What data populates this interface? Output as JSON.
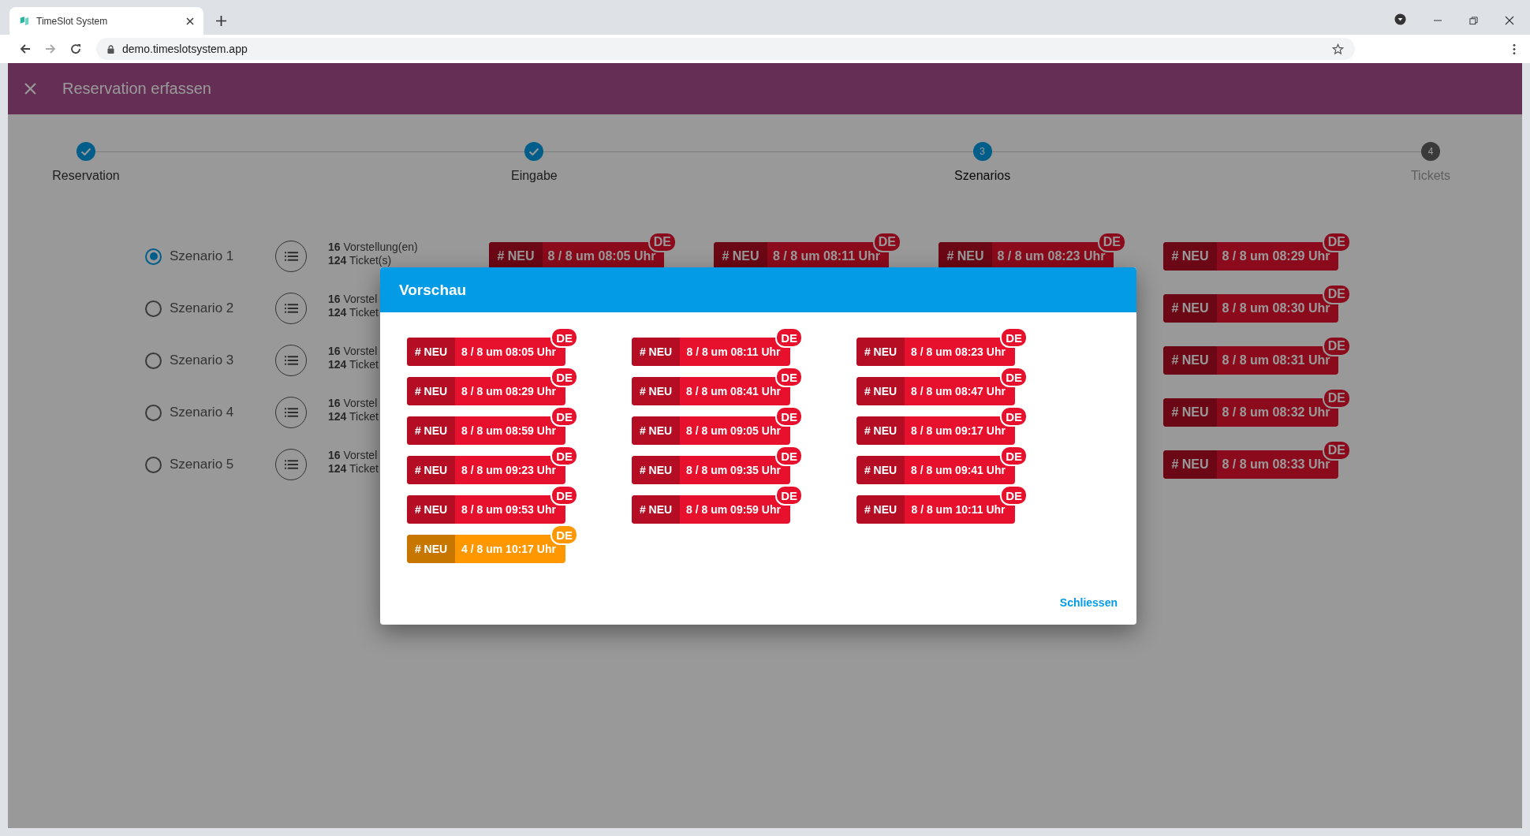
{
  "browser": {
    "tab_title": "TimeSlot System",
    "url": "demo.timeslotsystem.app"
  },
  "header": {
    "title": "Reservation erfassen"
  },
  "stepper": [
    {
      "label": "Reservation",
      "done": true,
      "selected": false
    },
    {
      "label": "Eingabe",
      "done": true,
      "selected": false
    },
    {
      "label": "Szenarios",
      "done": false,
      "selected": true,
      "number": "3"
    },
    {
      "label": "Tickets",
      "done": false,
      "selected": false,
      "number": "4"
    }
  ],
  "scenarios": [
    {
      "label": "Szenario 1",
      "selected": true,
      "performances": "**16** Vorstellung(en)",
      "tickets": "**124** Ticket(s)",
      "tags": [
        {
          "prefix": "# NEU",
          "text": "8 / 8 um 08:05 Uhr",
          "badge": "DE"
        },
        {
          "prefix": "# NEU",
          "text": "8 / 8 um 08:11 Uhr",
          "badge": "DE"
        },
        {
          "prefix": "# NEU",
          "text": "8 / 8 um 08:23 Uhr",
          "badge": "DE"
        },
        {
          "prefix": "# NEU",
          "text": "8 / 8 um 08:29 Uhr",
          "badge": "DE"
        }
      ]
    },
    {
      "label": "Szenario 2",
      "selected": false,
      "performances": "**16** Vorstel",
      "tickets": "**124** Ticket",
      "tags": [
        {
          "prefix": "# NEU",
          "text": "8 / 8 um 08:30 Uhr",
          "badge": "DE"
        }
      ]
    },
    {
      "label": "Szenario 3",
      "selected": false,
      "performances": "**16** Vorstel",
      "tickets": "**124** Ticket",
      "tags": [
        {
          "prefix": "# NEU",
          "text": "8 / 8 um 08:31 Uhr",
          "badge": "DE"
        }
      ]
    },
    {
      "label": "Szenario 4",
      "selected": false,
      "performances": "**16** Vorstel",
      "tickets": "**124** Ticket",
      "tags": [
        {
          "prefix": "# NEU",
          "text": "8 / 8 um 08:32 Uhr",
          "badge": "DE"
        }
      ]
    },
    {
      "label": "Szenario 5",
      "selected": false,
      "performances": "**16** Vorstel",
      "tickets": "**124** Ticket",
      "tags": [
        {
          "prefix": "# NEU",
          "text": "8 / 8 um 08:33 Uhr",
          "badge": "DE"
        }
      ]
    }
  ],
  "modal": {
    "title": "Vorschau",
    "tags": [
      {
        "prefix": "# NEU",
        "text": "8 / 8 um 08:05 Uhr",
        "badge": "DE",
        "color": "#e8112d"
      },
      {
        "prefix": "# NEU",
        "text": "8 / 8 um 08:11 Uhr",
        "badge": "DE",
        "color": "#e8112d"
      },
      {
        "prefix": "# NEU",
        "text": "8 / 8 um 08:23 Uhr",
        "badge": "DE",
        "color": "#e8112d"
      },
      {
        "prefix": "# NEU",
        "text": "8 / 8 um 08:29 Uhr",
        "badge": "DE",
        "color": "#e8112d"
      },
      {
        "prefix": "# NEU",
        "text": "8 / 8 um 08:41 Uhr",
        "badge": "DE",
        "color": "#e8112d"
      },
      {
        "prefix": "# NEU",
        "text": "8 / 8 um 08:47 Uhr",
        "badge": "DE",
        "color": "#e8112d"
      },
      {
        "prefix": "# NEU",
        "text": "8 / 8 um 08:59 Uhr",
        "badge": "DE",
        "color": "#e8112d"
      },
      {
        "prefix": "# NEU",
        "text": "8 / 8 um 09:05 Uhr",
        "badge": "DE",
        "color": "#e8112d"
      },
      {
        "prefix": "# NEU",
        "text": "8 / 8 um 09:17 Uhr",
        "badge": "DE",
        "color": "#e8112d"
      },
      {
        "prefix": "# NEU",
        "text": "8 / 8 um 09:23 Uhr",
        "badge": "DE",
        "color": "#e8112d"
      },
      {
        "prefix": "# NEU",
        "text": "8 / 8 um 09:35 Uhr",
        "badge": "DE",
        "color": "#e8112d"
      },
      {
        "prefix": "# NEU",
        "text": "8 / 8 um 09:41 Uhr",
        "badge": "DE",
        "color": "#e8112d"
      },
      {
        "prefix": "# NEU",
        "text": "8 / 8 um 09:53 Uhr",
        "badge": "DE",
        "color": "#e8112d"
      },
      {
        "prefix": "# NEU",
        "text": "8 / 8 um 09:59 Uhr",
        "badge": "DE",
        "color": "#e8112d"
      },
      {
        "prefix": "# NEU",
        "text": "8 / 8 um 10:11 Uhr",
        "badge": "DE",
        "color": "#e8112d"
      },
      {
        "prefix": "# NEU",
        "text": "4 / 8 um 10:17 Uhr",
        "badge": "DE",
        "color": "#ff9800"
      }
    ],
    "close_button": "Schliessen"
  }
}
